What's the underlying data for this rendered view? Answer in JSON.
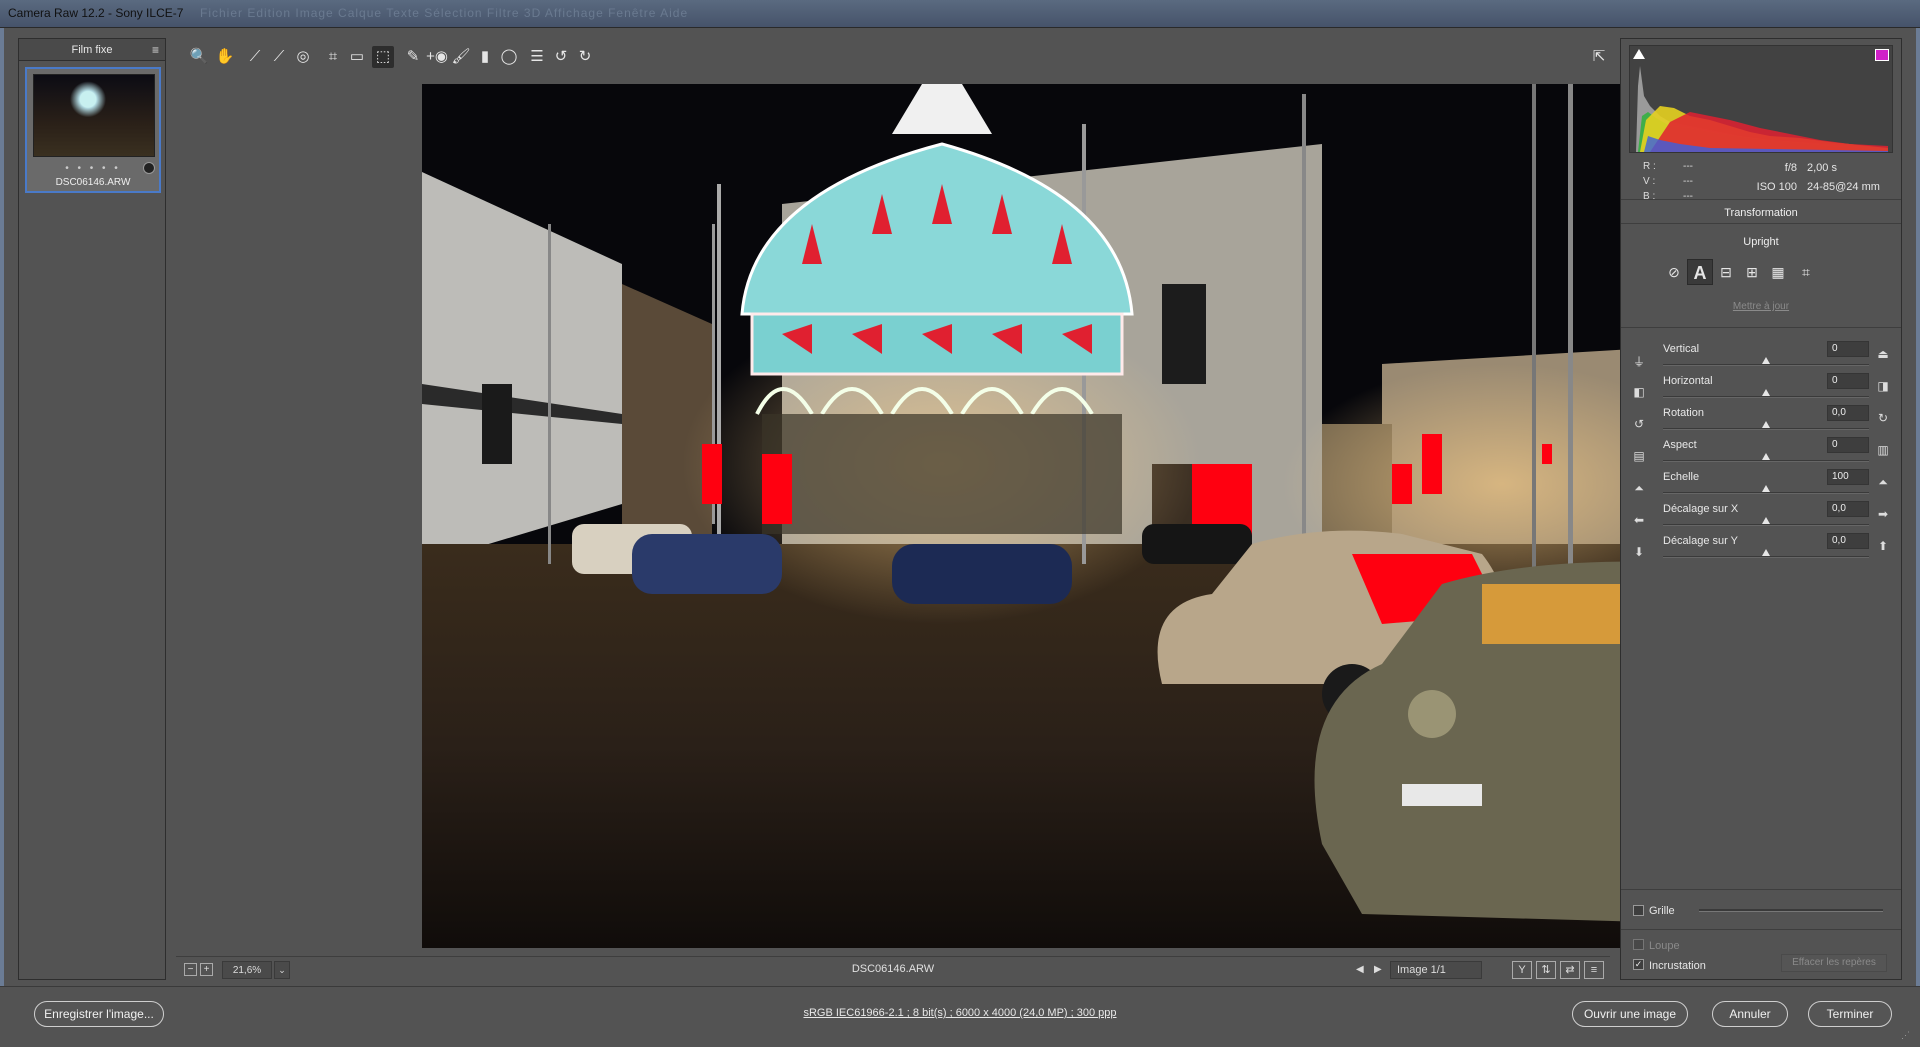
{
  "window": {
    "title": "Camera Raw 12.2  -  Sony ILCE-7",
    "ghost_menu": "Fichier   Edition   Image   Calque   Texte   Sélection   Filtre   3D   Affichage   Fenêtre   Aide"
  },
  "filmstrip": {
    "header": "Film fixe",
    "menu_icon": "≡",
    "thumb": {
      "dots": "• • • • •",
      "filename": "DSC06146.ARW"
    }
  },
  "toolbar": {
    "tools": [
      {
        "name": "zoom-tool",
        "glyph": "🔍"
      },
      {
        "name": "hand-tool",
        "glyph": "✋"
      },
      {
        "name": "white-balance-tool",
        "glyph": "⟋"
      },
      {
        "name": "color-sampler-tool",
        "glyph": "⟋"
      },
      {
        "name": "targeted-adjustment-tool",
        "glyph": "◎"
      },
      {
        "name": "crop-tool",
        "glyph": "⌗"
      },
      {
        "name": "straighten-tool",
        "glyph": "▭"
      },
      {
        "name": "transform-tool",
        "glyph": "⬚"
      },
      {
        "name": "spot-removal-tool",
        "glyph": "✎"
      },
      {
        "name": "red-eye-tool",
        "glyph": "+◉"
      },
      {
        "name": "adjustment-brush-tool",
        "glyph": "🖌"
      },
      {
        "name": "graduated-filter-tool",
        "glyph": "▮"
      },
      {
        "name": "radial-filter-tool",
        "glyph": "◯"
      },
      {
        "name": "preferences-tool",
        "glyph": "☰"
      },
      {
        "name": "rotate-ccw-tool",
        "glyph": "↺"
      },
      {
        "name": "rotate-cw-tool",
        "glyph": "↻"
      }
    ],
    "fullscreen_glyph": "⇱"
  },
  "statusbar": {
    "zoom_out": "−",
    "zoom_in": "+",
    "zoom_value": "21,6%",
    "zoom_dropdown": "⌄",
    "filename": "DSC06146.ARW",
    "prev": "◀",
    "next": "▶",
    "image_count": "Image 1/1",
    "view_buttons": [
      "Y",
      "⇅",
      "⇄",
      "≡"
    ]
  },
  "histogram": {
    "rgb": [
      {
        "k": "R :",
        "v": "---"
      },
      {
        "k": "V :",
        "v": "---"
      },
      {
        "k": "B :",
        "v": "---"
      }
    ],
    "exif": [
      {
        "a": "f/8",
        "b": "2,00 s"
      },
      {
        "a": "ISO 100",
        "b": "24-85@24 mm"
      }
    ]
  },
  "panel": {
    "title": "Transformation",
    "upright_label": "Upright",
    "upright_buttons": [
      "⊘",
      "A",
      "⊟",
      "⊞",
      "▦",
      "⌗"
    ],
    "update_link": "Mettre à jour",
    "sliders": [
      {
        "label": "Vertical",
        "value": "0",
        "level": 0.5,
        "icon_l": "⏚",
        "icon_r": "⏏"
      },
      {
        "label": "Horizontal",
        "value": "0",
        "level": 0.5,
        "icon_l": "◧",
        "icon_r": "◨"
      },
      {
        "label": "Rotation",
        "value": "0,0",
        "level": 0.5,
        "icon_l": "↺",
        "icon_r": "↻"
      },
      {
        "label": "Aspect",
        "value": "0",
        "level": 0.5,
        "icon_l": "▤",
        "icon_r": "▥"
      },
      {
        "label": "Echelle",
        "value": "100",
        "level": 0.5,
        "icon_l": "⏶",
        "icon_r": "⏶"
      },
      {
        "label": "Décalage sur X",
        "value": "0,0",
        "level": 0.5,
        "icon_l": "⬅",
        "icon_r": "➡"
      },
      {
        "label": "Décalage sur Y",
        "value": "0,0",
        "level": 0.5,
        "icon_l": "⬇",
        "icon_r": "⬆"
      }
    ],
    "grid_label": "Grille",
    "loupe_label": "Loupe",
    "overlay_label": "Incrustation",
    "overlay_check": "✓",
    "clear_guides": "Effacer les repères"
  },
  "footer": {
    "save": "Enregistrer l'image...",
    "workflow": "sRGB IEC61966-2.1 ; 8 bit(s) ; 6000 x 4000 (24,0 MP) ; 300 ppp",
    "open": "Ouvrir une image",
    "cancel": "Annuler",
    "done": "Terminer"
  }
}
